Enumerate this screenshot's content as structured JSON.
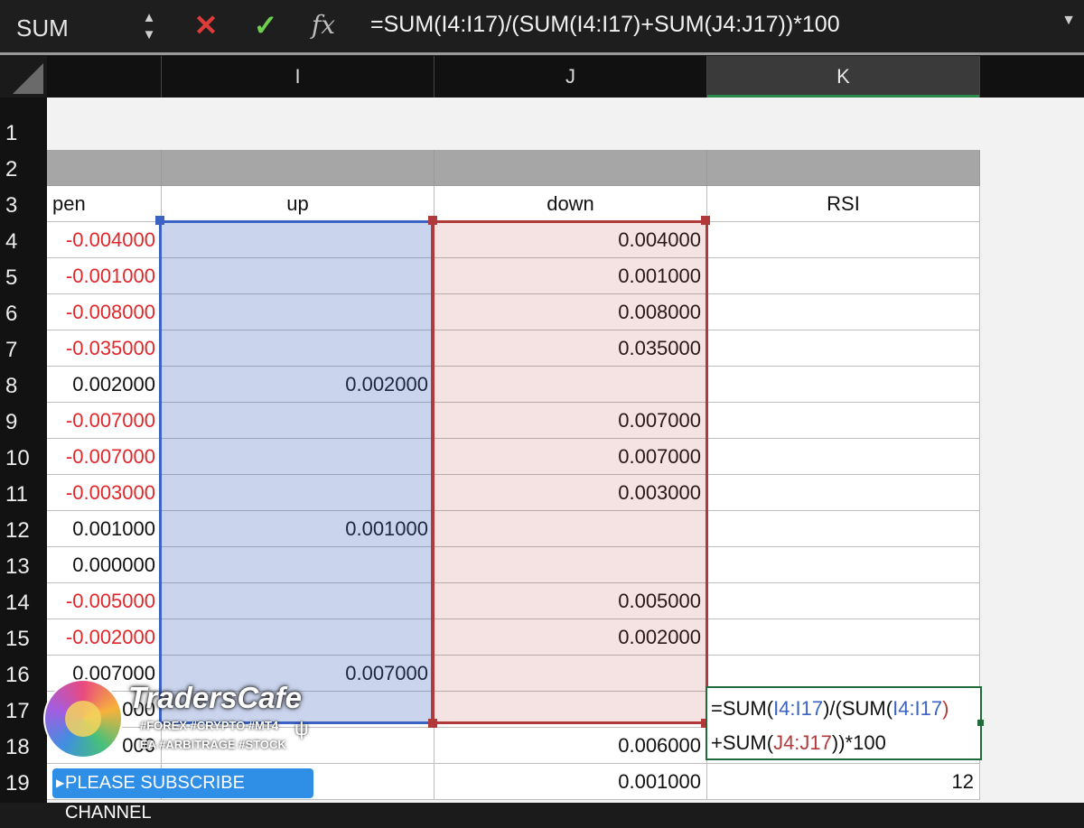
{
  "formula_bar": {
    "name_box": "SUM",
    "cancel_icon": "✕",
    "enter_icon": "✓",
    "fx_label": "fx",
    "formula": "=SUM(I4:I17)/(SUM(I4:I17)+SUM(J4:J17))*100"
  },
  "columns": [
    "I",
    "J",
    "K"
  ],
  "rows": [
    "1",
    "2",
    "3",
    "4",
    "5",
    "6",
    "7",
    "8",
    "9",
    "10",
    "11",
    "12",
    "13",
    "14",
    "15",
    "16",
    "17",
    "18",
    "19"
  ],
  "headers": {
    "h": "pen",
    "i": "up",
    "j": "down",
    "k": "RSI"
  },
  "data_rows": [
    {
      "h": "-0.004000",
      "i": "",
      "j": "0.004000",
      "k": ""
    },
    {
      "h": "-0.001000",
      "i": "",
      "j": "0.001000",
      "k": ""
    },
    {
      "h": "-0.008000",
      "i": "",
      "j": "0.008000",
      "k": ""
    },
    {
      "h": "-0.035000",
      "i": "",
      "j": "0.035000",
      "k": ""
    },
    {
      "h": "0.002000",
      "i": "0.002000",
      "j": "",
      "k": ""
    },
    {
      "h": "-0.007000",
      "i": "",
      "j": "0.007000",
      "k": ""
    },
    {
      "h": "-0.007000",
      "i": "",
      "j": "0.007000",
      "k": ""
    },
    {
      "h": "-0.003000",
      "i": "",
      "j": "0.003000",
      "k": ""
    },
    {
      "h": "0.001000",
      "i": "0.001000",
      "j": "",
      "k": ""
    },
    {
      "h": "0.000000",
      "i": "",
      "j": "",
      "k": ""
    },
    {
      "h": "-0.005000",
      "i": "",
      "j": "0.005000",
      "k": ""
    },
    {
      "h": "-0.002000",
      "i": "",
      "j": "0.002000",
      "k": ""
    },
    {
      "h": "0.007000",
      "i": "0.007000",
      "j": "",
      "k": ""
    },
    {
      "h": "000",
      "i": "",
      "j": "",
      "k": ""
    },
    {
      "h": "000",
      "i": "",
      "j": "0.006000",
      "k": ""
    },
    {
      "h": "",
      "i": "",
      "j": "0.001000",
      "k": "12"
    }
  ],
  "edit_cell": {
    "p1": "=SUM(",
    "p2": "I4:I17",
    "p3": ")/(SUM(",
    "p4": "I4:I17",
    "p5": ")",
    "p6": "+SUM(",
    "p7": "J4:J17",
    "p8": "))*100"
  },
  "overlay": {
    "brand": "TradersCafe",
    "tags_line1": "#FOREX #CRYPTO #MT4",
    "tags_line2": "EA #ARBITRAGE #STOCK",
    "subscribe": "PLEASE SUBSCRIBE CHANNEL"
  },
  "colors": {
    "negative": "#e0272b",
    "range_i": "#3b63c4",
    "range_j": "#b03a3a",
    "active_cell": "#1f6b3a"
  }
}
